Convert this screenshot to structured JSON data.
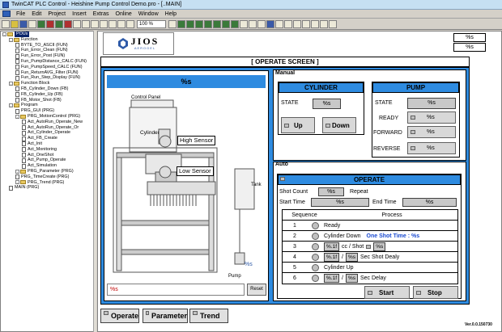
{
  "window": {
    "title": "TwinCAT PLC Control - Heishine Pump Control Demo.pro - [..MAIN]"
  },
  "menu": [
    "File",
    "Edit",
    "Project",
    "Insert",
    "Extras",
    "Online",
    "Window",
    "Help"
  ],
  "toolbar": {
    "zoom": "100 %"
  },
  "tree": {
    "root": "POUs",
    "nodes": [
      {
        "label": "POUs",
        "level": 0,
        "kind": "folder",
        "selected": true
      },
      {
        "label": "Function",
        "level": 1,
        "kind": "folder"
      },
      {
        "label": "BYTE_TO_ASCII (FUN)",
        "level": 2,
        "kind": "doc"
      },
      {
        "label": "Fun_Error_Clean (FUN)",
        "level": 2,
        "kind": "doc"
      },
      {
        "label": "Fun_Error_Post (FUN)",
        "level": 2,
        "kind": "doc"
      },
      {
        "label": "Fun_PumpDistance_CALC (FUN)",
        "level": 2,
        "kind": "doc"
      },
      {
        "label": "Fun_PumpSpeed_CALC (FUN)",
        "level": 2,
        "kind": "doc"
      },
      {
        "label": "Fun_ReturnAVG_Filter (FUN)",
        "level": 2,
        "kind": "doc"
      },
      {
        "label": "Fun_Run_Step_Display (FUN)",
        "level": 2,
        "kind": "doc"
      },
      {
        "label": "Function Block",
        "level": 1,
        "kind": "folder"
      },
      {
        "label": "FB_Cylinder_Down (FB)",
        "level": 2,
        "kind": "doc"
      },
      {
        "label": "FB_Cylinder_Up (FB)",
        "level": 2,
        "kind": "doc"
      },
      {
        "label": "FB_Motor_Shot (FB)",
        "level": 2,
        "kind": "doc"
      },
      {
        "label": "Program",
        "level": 1,
        "kind": "folder"
      },
      {
        "label": "PRG_GUI (PRG)",
        "level": 2,
        "kind": "doc"
      },
      {
        "label": "PRG_MotionControl (PRG)",
        "level": 2,
        "kind": "folder"
      },
      {
        "label": "Act_AutoRun_Operate_New",
        "level": 3,
        "kind": "doc"
      },
      {
        "label": "Act_AutoRun_Operate_Or",
        "level": 3,
        "kind": "doc"
      },
      {
        "label": "Act_Cylinder_Operate",
        "level": 3,
        "kind": "doc"
      },
      {
        "label": "Act_FB_Create",
        "level": 3,
        "kind": "doc"
      },
      {
        "label": "Act_Init",
        "level": 3,
        "kind": "doc"
      },
      {
        "label": "Act_Monitoring",
        "level": 3,
        "kind": "doc"
      },
      {
        "label": "Act_OneShot",
        "level": 3,
        "kind": "doc"
      },
      {
        "label": "Act_Pump_Operate",
        "level": 3,
        "kind": "doc"
      },
      {
        "label": "Act_Simulation",
        "level": 3,
        "kind": "doc"
      },
      {
        "label": "PRG_Parameter (PRG)",
        "level": 2,
        "kind": "folder"
      },
      {
        "label": "PRG_TimeCreate (PRG)",
        "level": 2,
        "kind": "doc"
      },
      {
        "label": "PRG_Trend (PRG)",
        "level": 2,
        "kind": "folder"
      },
      {
        "label": "MAIN (PRG)",
        "level": 1,
        "kind": "doc"
      }
    ]
  },
  "header": {
    "logo": "JIOS",
    "logo_sub": "AEROGEL",
    "top_right": "%s",
    "top_right2": "%s"
  },
  "screen": {
    "title": "[ OPERATE SCREEN ]",
    "status_display": "%s",
    "control_panel_label": "Control Panel",
    "cylinder_label": "Cylinder",
    "high_sensor": "High Sensor",
    "low_sensor": "Low Sensor",
    "tank_label": "Tank",
    "pump_label": "Pump",
    "pump_value": "%s",
    "message": "%s",
    "reset_label": "Reset"
  },
  "manual": {
    "label": "Manual",
    "cylinder": {
      "title": "CYLINDER",
      "state_label": "STATE",
      "state_value": "%s",
      "up": "Up",
      "down": "Down"
    },
    "pump": {
      "title": "PUMP",
      "state_label": "STATE",
      "state_value": "%s",
      "ready_label": "READY",
      "ready_value": "%s",
      "forward_label": "FORWARD",
      "forward_value": "%s",
      "reverse_label": "REVERSE",
      "reverse_value": "%s"
    }
  },
  "auto": {
    "label": "Auto",
    "operate": {
      "title": "OPERATE",
      "shot_count_label": "Shot Count",
      "shot_count_value": "%s",
      "repeat_label": "Repeat",
      "start_time_label": "Start Time",
      "start_time_value": "%s",
      "end_time_label": "End Time",
      "end_time_value": "%s",
      "seq_header": "Sequence",
      "proc_header": "Process",
      "rows": [
        {
          "n": "1",
          "text": "Ready"
        },
        {
          "n": "2",
          "text": "Cylinder Down",
          "extra": "One Shot Time : %s"
        },
        {
          "n": "3",
          "box1": "%.1f",
          "text": "cc / Shot",
          "box2": "%s"
        },
        {
          "n": "4",
          "box1": "%.1f",
          "sep": "/",
          "box2": "%s",
          "text": "Sec Shot Dealy"
        },
        {
          "n": "5",
          "text": "Cylinder Up"
        },
        {
          "n": "6",
          "box1": "%.1f",
          "sep": "/",
          "box2": "%s",
          "text": "Sec Delay"
        }
      ],
      "start": "Start",
      "stop": "Stop"
    }
  },
  "bottom": {
    "operate": "Operate",
    "parameter": "Parameter",
    "trend": "Trend",
    "version": "Ver.0.0.150730"
  },
  "colors": {
    "accent": "#2e8be0",
    "titlebar": "#c6e0f2",
    "selection": "#0a246a"
  }
}
